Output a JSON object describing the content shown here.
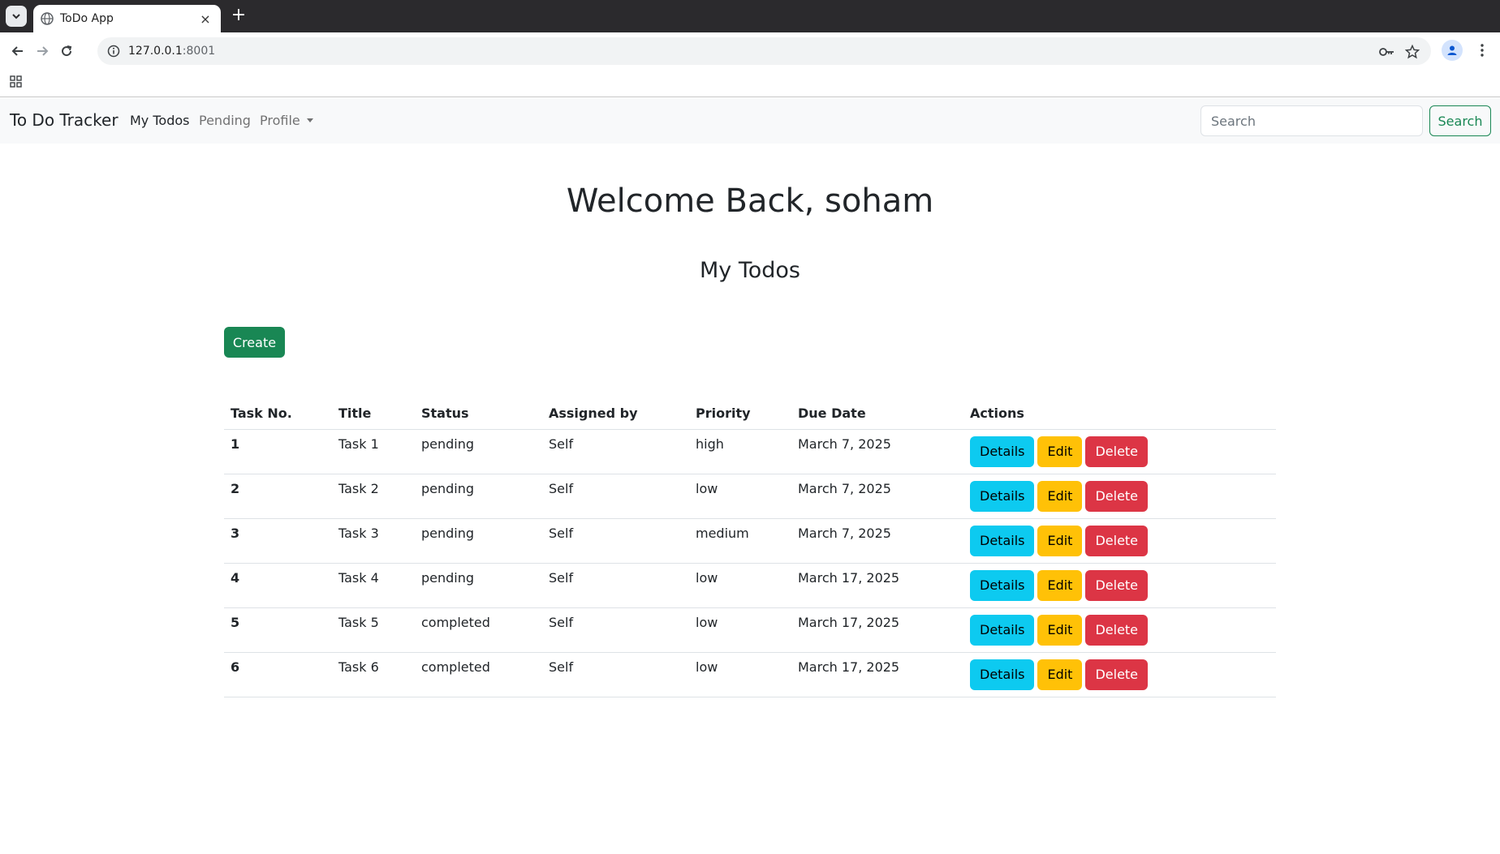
{
  "browser": {
    "tab_title": "ToDo App",
    "new_tab_symbol": "+",
    "close_symbol": "×",
    "url_host": "127.0.0.1",
    "url_port": ":8001"
  },
  "navbar": {
    "brand": "To Do Tracker",
    "links": [
      "My Todos",
      "Pending",
      "Profile"
    ],
    "search_placeholder": "Search",
    "search_button": "Search"
  },
  "main": {
    "welcome": "Welcome Back, soham",
    "section_title": "My Todos",
    "create_button": "Create"
  },
  "table": {
    "headers": [
      "Task No.",
      "Title",
      "Status",
      "Assigned by",
      "Priority",
      "Due Date",
      "Actions"
    ],
    "rows": [
      {
        "no": "1",
        "title": "Task 1",
        "status": "pending",
        "assigned_by": "Self",
        "priority": "high",
        "due": "March 7, 2025"
      },
      {
        "no": "2",
        "title": "Task 2",
        "status": "pending",
        "assigned_by": "Self",
        "priority": "low",
        "due": "March 7, 2025"
      },
      {
        "no": "3",
        "title": "Task 3",
        "status": "pending",
        "assigned_by": "Self",
        "priority": "medium",
        "due": "March 7, 2025"
      },
      {
        "no": "4",
        "title": "Task 4",
        "status": "pending",
        "assigned_by": "Self",
        "priority": "low",
        "due": "March 17, 2025"
      },
      {
        "no": "5",
        "title": "Task 5",
        "status": "completed",
        "assigned_by": "Self",
        "priority": "low",
        "due": "March 17, 2025"
      },
      {
        "no": "6",
        "title": "Task 6",
        "status": "completed",
        "assigned_by": "Self",
        "priority": "low",
        "due": "March 17, 2025"
      }
    ],
    "actions": {
      "details": "Details",
      "edit": "Edit",
      "delete": "Delete"
    }
  },
  "colors": {
    "success": "#198754",
    "info": "#0dcaf0",
    "warning": "#ffc107",
    "danger": "#dc3545"
  }
}
